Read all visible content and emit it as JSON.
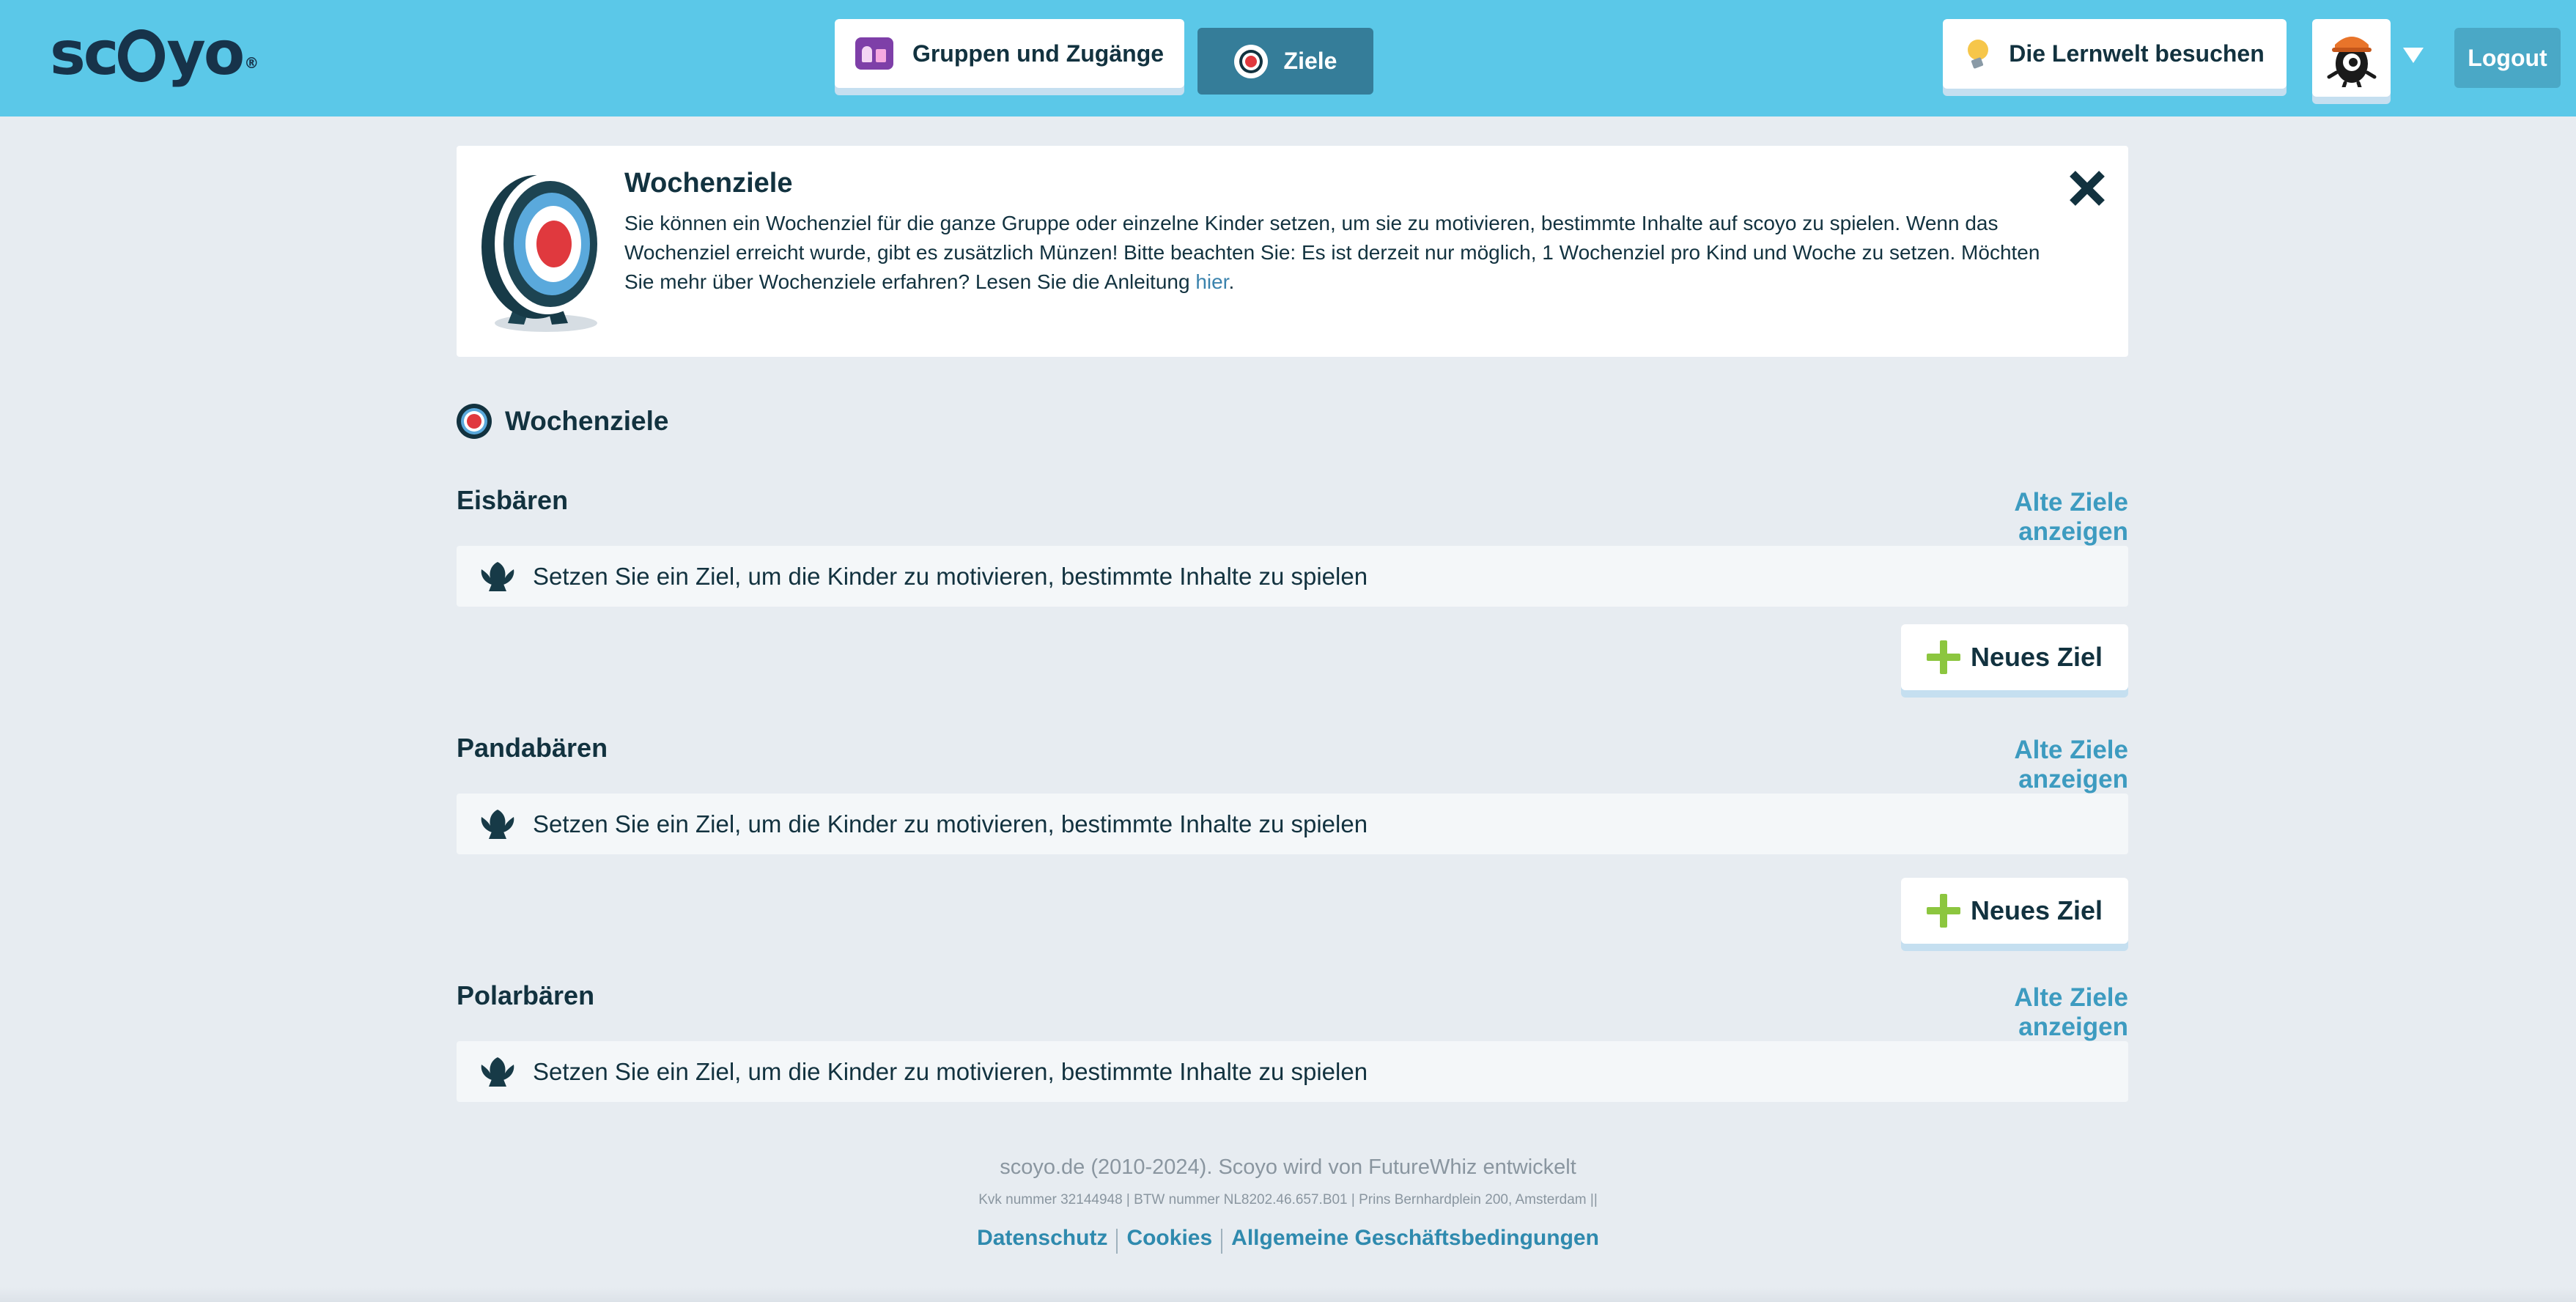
{
  "header": {
    "logo_text_1": "sc",
    "logo_text_2": "yo",
    "logo_reg": "®",
    "nav": {
      "groups_label": "Gruppen und Zugänge",
      "goals_label": "Ziele",
      "lernwelt_label": "Die Lernwelt besuchen",
      "logout_label": "Logout"
    }
  },
  "info": {
    "title": "Wochenziele",
    "text": "Sie können ein Wochenziel für die ganze Gruppe oder einzelne Kinder setzen, um sie zu motivieren, bestimmte Inhalte auf scoyo zu spielen. Wenn das Wochenziel erreicht wurde, gibt es zusätzlich Münzen! Bitte beachten Sie: Es ist derzeit nur möglich, 1 Wochenziel pro Kind und Woche zu setzen. Möchten Sie mehr über Wochenziele erfahren? Lesen Sie die Anleitung ",
    "link_text": "hier",
    "text_end": "."
  },
  "section": {
    "title": "Wochenziele"
  },
  "groups": [
    {
      "name": "Eisbären",
      "old_goals_label": "Alte Ziele anzeigen",
      "empty_text": "Setzen Sie ein Ziel, um die Kinder zu motivieren, bestimmte Inhalte zu spielen",
      "new_goal_label": "Neues Ziel"
    },
    {
      "name": "Pandabären",
      "old_goals_label": "Alte Ziele anzeigen",
      "empty_text": "Setzen Sie ein Ziel, um die Kinder zu motivieren, bestimmte Inhalte zu spielen",
      "new_goal_label": "Neues Ziel"
    },
    {
      "name": "Polarbären",
      "old_goals_label": "Alte Ziele anzeigen",
      "empty_text": "Setzen Sie ein Ziel, um die Kinder zu motivieren, bestimmte Inhalte zu spielen"
    }
  ],
  "footer": {
    "copyright": "scoyo.de (2010-2024). Scoyo wird von FutureWhiz entwickelt",
    "legal": "Kvk nummer 32144948 | BTW nummer NL8202.46.657.B01 | Prins Bernhardplein 200, Amsterdam ||",
    "links": [
      "Datenschutz",
      "Cookies",
      "Allgemeine Geschäftsbedingungen"
    ]
  },
  "colors": {
    "header_bg": "#5bc8e8",
    "page_bg": "#e7ecf1",
    "accent_dark": "#357d99",
    "link_blue": "#3d9bc0",
    "plus_green": "#8cc63f",
    "target_red": "#e0393e"
  },
  "icons": [
    "groups-icon",
    "target-icon",
    "lightbulb-icon",
    "avatar-icon",
    "chevron-down-icon",
    "close-icon",
    "fan-icon",
    "plus-icon"
  ]
}
